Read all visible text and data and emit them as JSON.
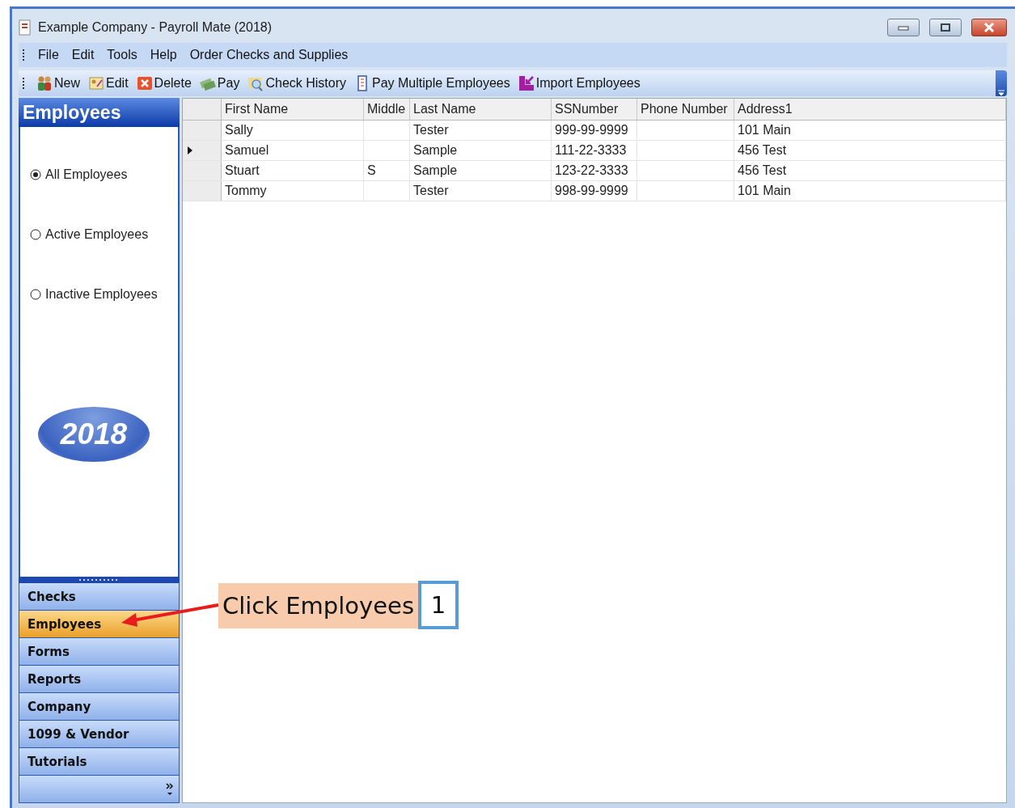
{
  "window": {
    "title": "Example Company - Payroll Mate (2018)"
  },
  "menu": [
    "File",
    "Edit",
    "Tools",
    "Help",
    "Order Checks and Supplies"
  ],
  "toolbar": [
    {
      "label": "New",
      "kind": "new"
    },
    {
      "label": "Edit",
      "kind": "edit"
    },
    {
      "label": "Delete",
      "kind": "delete"
    },
    {
      "label": "Pay",
      "kind": "pay"
    },
    {
      "label": "Check History",
      "kind": "history"
    },
    {
      "label": "Pay Multiple Employees",
      "kind": "multi"
    },
    {
      "label": "Import Employees",
      "kind": "import"
    }
  ],
  "sidebar": {
    "title": "Employees",
    "filters": [
      {
        "label": "All Employees",
        "selected": true
      },
      {
        "label": "Active Employees",
        "selected": false
      },
      {
        "label": "Inactive Employees",
        "selected": false
      }
    ],
    "logo_text": "2018",
    "nav": [
      {
        "label": "Checks",
        "selected": false
      },
      {
        "label": "Employees",
        "selected": true
      },
      {
        "label": "Forms",
        "selected": false
      },
      {
        "label": "Reports",
        "selected": false
      },
      {
        "label": "Company",
        "selected": false
      },
      {
        "label": "1099 & Vendor",
        "selected": false
      },
      {
        "label": "Tutorials",
        "selected": false
      }
    ]
  },
  "table": {
    "columns": [
      "First Name",
      "Middle",
      "Last Name",
      "SSNumber",
      "Phone Number",
      "Address1"
    ],
    "rows": [
      {
        "cells": [
          "Sally",
          "",
          "Tester",
          "999-99-9999",
          "",
          "101 Main"
        ],
        "selected": false
      },
      {
        "cells": [
          "Samuel",
          "",
          "Sample",
          "111-22-3333",
          "",
          "456 Test"
        ],
        "selected": true
      },
      {
        "cells": [
          "Stuart",
          "S",
          "Sample",
          "123-22-3333",
          "",
          "456 Test"
        ],
        "selected": false
      },
      {
        "cells": [
          "Tommy",
          "",
          "Tester",
          "998-99-9999",
          "",
          "101 Main"
        ],
        "selected": false
      }
    ]
  },
  "callout": {
    "text": "Click Employees",
    "step": "1"
  }
}
